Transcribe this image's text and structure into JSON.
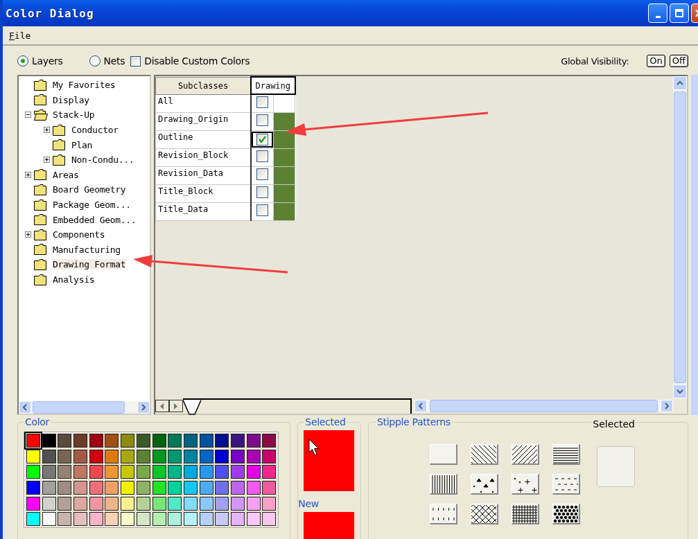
{
  "window": {
    "title": "Color Dialog"
  },
  "menu": [
    {
      "label": "File"
    }
  ],
  "view_options": [
    {
      "label": "Layers",
      "selected": true
    },
    {
      "label": "Nets",
      "selected": false
    }
  ],
  "disable_custom_colors": {
    "label": "Disable Custom Colors",
    "checked": false
  },
  "global_visibility": {
    "label": "Global Visibility:",
    "buttons": [
      "On",
      "Off"
    ]
  },
  "tree": [
    {
      "label": "My Favorites",
      "selected": false
    },
    {
      "label": "Display",
      "selected": false
    },
    {
      "label": "Stack-Up",
      "selected": false,
      "expanded": true,
      "children": [
        {
          "label": "Conductor",
          "selected": false,
          "expanded": false
        },
        {
          "label": "Plan",
          "selected": false
        },
        {
          "label": "Non-Condu...",
          "selected": false,
          "expanded": false
        }
      ]
    },
    {
      "label": "Areas",
      "selected": false,
      "expanded": false
    },
    {
      "label": "Board Geometry",
      "selected": false
    },
    {
      "label": "Package Geom...",
      "selected": false
    },
    {
      "label": "Embedded Geom...",
      "selected": false
    },
    {
      "label": "Components",
      "selected": false,
      "expanded": false
    },
    {
      "label": "Manufacturing",
      "selected": false
    },
    {
      "label": "Drawing Format",
      "selected": true
    },
    {
      "label": "Analysis",
      "selected": false
    }
  ],
  "subclass_table": {
    "columns": [
      "Subclasses",
      "Drawing"
    ],
    "rows": [
      {
        "name": "All",
        "checked": false,
        "focused": false
      },
      {
        "name": "Drawing_Origin",
        "checked": false,
        "focused": false,
        "color": "#5a8232"
      },
      {
        "name": "Outline",
        "checked": true,
        "focused": true,
        "color": "#5a8232"
      },
      {
        "name": "Revision_Block",
        "checked": false,
        "focused": false,
        "color": "#5a8232"
      },
      {
        "name": "Revision_Data",
        "checked": false,
        "focused": false,
        "color": "#5a8232"
      },
      {
        "name": "Title_Block",
        "checked": false,
        "focused": false,
        "color": "#5a8232"
      },
      {
        "name": "Title_Data",
        "checked": false,
        "focused": false,
        "color": "#5a8232"
      }
    ]
  },
  "color_palette": {
    "label": "Color",
    "rows": [
      {
        "swatches": [
          {
            "color": "#ff0000",
            "selected": true
          },
          {
            "color": "#000000",
            "selected": false
          },
          {
            "color": "#5a4a3c",
            "selected": false
          },
          {
            "color": "#6b3c28",
            "selected": false
          },
          {
            "color": "#a00010",
            "selected": false
          },
          {
            "color": "#a05010",
            "selected": false
          },
          {
            "color": "#8c8c10",
            "selected": false
          },
          {
            "color": "#3c5a28",
            "selected": false
          },
          {
            "color": "#006410",
            "selected": false
          },
          {
            "color": "#007858",
            "selected": false
          },
          {
            "color": "#006480",
            "selected": false
          },
          {
            "color": "#0050a0",
            "selected": false
          },
          {
            "color": "#001090",
            "selected": false
          },
          {
            "color": "#3c1480",
            "selected": false
          },
          {
            "color": "#7c0a8c",
            "selected": false
          },
          {
            "color": "#8c0a46",
            "selected": false
          }
        ]
      },
      {
        "swatches": [
          {
            "color": "#ffff00",
            "selected": false
          },
          {
            "color": "#505050",
            "selected": false
          },
          {
            "color": "#786450",
            "selected": false
          },
          {
            "color": "#a05a46",
            "selected": false
          },
          {
            "color": "#d00010",
            "selected": false
          },
          {
            "color": "#e07810",
            "selected": false
          },
          {
            "color": "#a8a810",
            "selected": false
          },
          {
            "color": "#5a8232",
            "selected": false
          },
          {
            "color": "#009620",
            "selected": false
          },
          {
            "color": "#00966e",
            "selected": false
          },
          {
            "color": "#0082a0",
            "selected": false
          },
          {
            "color": "#0064c8",
            "selected": false
          },
          {
            "color": "#0000d2",
            "selected": false
          },
          {
            "color": "#7800c8",
            "selected": false
          },
          {
            "color": "#aa00b4",
            "selected": false
          },
          {
            "color": "#c8006e",
            "selected": false
          }
        ]
      },
      {
        "swatches": [
          {
            "color": "#00ff00",
            "selected": false
          },
          {
            "color": "#787878",
            "selected": false
          },
          {
            "color": "#968270",
            "selected": false
          },
          {
            "color": "#c07864",
            "selected": false
          },
          {
            "color": "#f04650",
            "selected": false
          },
          {
            "color": "#f09632",
            "selected": false
          },
          {
            "color": "#c8c800",
            "selected": false
          },
          {
            "color": "#78aa46",
            "selected": false
          },
          {
            "color": "#00c828",
            "selected": false
          },
          {
            "color": "#00b48c",
            "selected": false
          },
          {
            "color": "#00aadc",
            "selected": false
          },
          {
            "color": "#2896f0",
            "selected": false
          },
          {
            "color": "#5050f0",
            "selected": false
          },
          {
            "color": "#a03cf0",
            "selected": false
          },
          {
            "color": "#e600e6",
            "selected": false
          },
          {
            "color": "#f0288c",
            "selected": false
          }
        ]
      },
      {
        "swatches": [
          {
            "color": "#0000ff",
            "selected": false
          },
          {
            "color": "#a0a0a0",
            "selected": false
          },
          {
            "color": "#a08c82",
            "selected": false
          },
          {
            "color": "#d4968c",
            "selected": false
          },
          {
            "color": "#f06e78",
            "selected": false
          },
          {
            "color": "#f0a064",
            "selected": false
          },
          {
            "color": "#f0f000",
            "selected": false
          },
          {
            "color": "#8cb464",
            "selected": false
          },
          {
            "color": "#1ee628",
            "selected": false
          },
          {
            "color": "#00d2a0",
            "selected": false
          },
          {
            "color": "#14c8f0",
            "selected": false
          },
          {
            "color": "#50aaf0",
            "selected": false
          },
          {
            "color": "#7070ee",
            "selected": false
          },
          {
            "color": "#be64ee",
            "selected": false
          },
          {
            "color": "#f05af0",
            "selected": false
          },
          {
            "color": "#f05aa0",
            "selected": false
          }
        ]
      },
      {
        "swatches": [
          {
            "color": "#ff00ff",
            "selected": false
          },
          {
            "color": "#d2d2d2",
            "selected": false
          },
          {
            "color": "#b4a096",
            "selected": false
          },
          {
            "color": "#dca8a0",
            "selected": false
          },
          {
            "color": "#f096a0",
            "selected": false
          },
          {
            "color": "#f0b48c",
            "selected": false
          },
          {
            "color": "#f8f08c",
            "selected": false
          },
          {
            "color": "#b4d296",
            "selected": false
          },
          {
            "color": "#78e678",
            "selected": false
          },
          {
            "color": "#50e6c8",
            "selected": false
          },
          {
            "color": "#82dcf8",
            "selected": false
          },
          {
            "color": "#8cc8f8",
            "selected": false
          },
          {
            "color": "#a0a0f4",
            "selected": false
          },
          {
            "color": "#d296f4",
            "selected": false
          },
          {
            "color": "#f8a0f4",
            "selected": false
          },
          {
            "color": "#f8a0c8",
            "selected": false
          }
        ]
      },
      {
        "swatches": [
          {
            "color": "#00ffff",
            "selected": false
          },
          {
            "color": "#f8f8f8",
            "selected": false
          },
          {
            "color": "#c8b4aa",
            "selected": false
          },
          {
            "color": "#e6bebe",
            "selected": false
          },
          {
            "color": "#f8b4c8",
            "selected": false
          },
          {
            "color": "#f8d2b4",
            "selected": false
          },
          {
            "color": "#f8f8c8",
            "selected": false
          },
          {
            "color": "#d2e6c8",
            "selected": false
          },
          {
            "color": "#b4f0b4",
            "selected": false
          },
          {
            "color": "#aaf0dc",
            "selected": false
          },
          {
            "color": "#b4f0f8",
            "selected": false
          },
          {
            "color": "#b4d2f8",
            "selected": false
          },
          {
            "color": "#c8c8f8",
            "selected": false
          },
          {
            "color": "#e6b4f8",
            "selected": false
          },
          {
            "color": "#f8c8f8",
            "selected": false
          },
          {
            "color": "#f8c8f0",
            "selected": false
          }
        ]
      }
    ]
  },
  "selected_color": {
    "label": "Selected",
    "color": "#ff0000"
  },
  "new_color": {
    "label": "New",
    "color": "#ff0000"
  },
  "stipple": {
    "label": "Stipple Patterns",
    "selected_label": "Selected",
    "patterns": [
      {
        "kind": "blank"
      },
      {
        "kind": "diagonal-down"
      },
      {
        "kind": "diagonal-up"
      },
      {
        "kind": "horizontal"
      },
      {
        "kind": "vertical"
      },
      {
        "kind": "triangles"
      },
      {
        "kind": "crosses"
      },
      {
        "kind": "dashes"
      },
      {
        "kind": "ticks"
      },
      {
        "kind": "crosshatch"
      },
      {
        "kind": "grid"
      },
      {
        "kind": "dots"
      }
    ]
  }
}
